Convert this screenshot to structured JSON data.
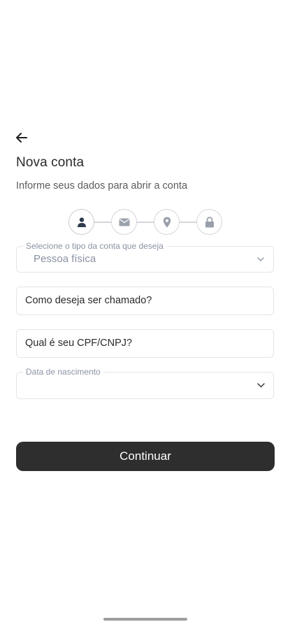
{
  "header": {
    "back_icon": "arrow-left-icon",
    "title": "Nova conta",
    "subtitle": "Informe seus dados para abrir a conta"
  },
  "stepper": {
    "steps": [
      {
        "icon": "person-icon",
        "active": true
      },
      {
        "icon": "envelope-icon",
        "active": false
      },
      {
        "icon": "location-pin-icon",
        "active": false
      },
      {
        "icon": "lock-icon",
        "active": false
      }
    ],
    "colors": {
      "active": "#2f3a4d",
      "inactive": "#9aa0ab"
    }
  },
  "form": {
    "account_type": {
      "label": "Selecione o tipo da conta que deseja",
      "value": "Pessoa física"
    },
    "nickname": {
      "placeholder": "Como deseja ser chamado?"
    },
    "document": {
      "placeholder": "Qual é seu CPF/CNPJ?"
    },
    "birth_date": {
      "label": "Data de nascimento",
      "value": ""
    }
  },
  "actions": {
    "continue_label": "Continuar",
    "continue_color": "#2e2e2e"
  }
}
